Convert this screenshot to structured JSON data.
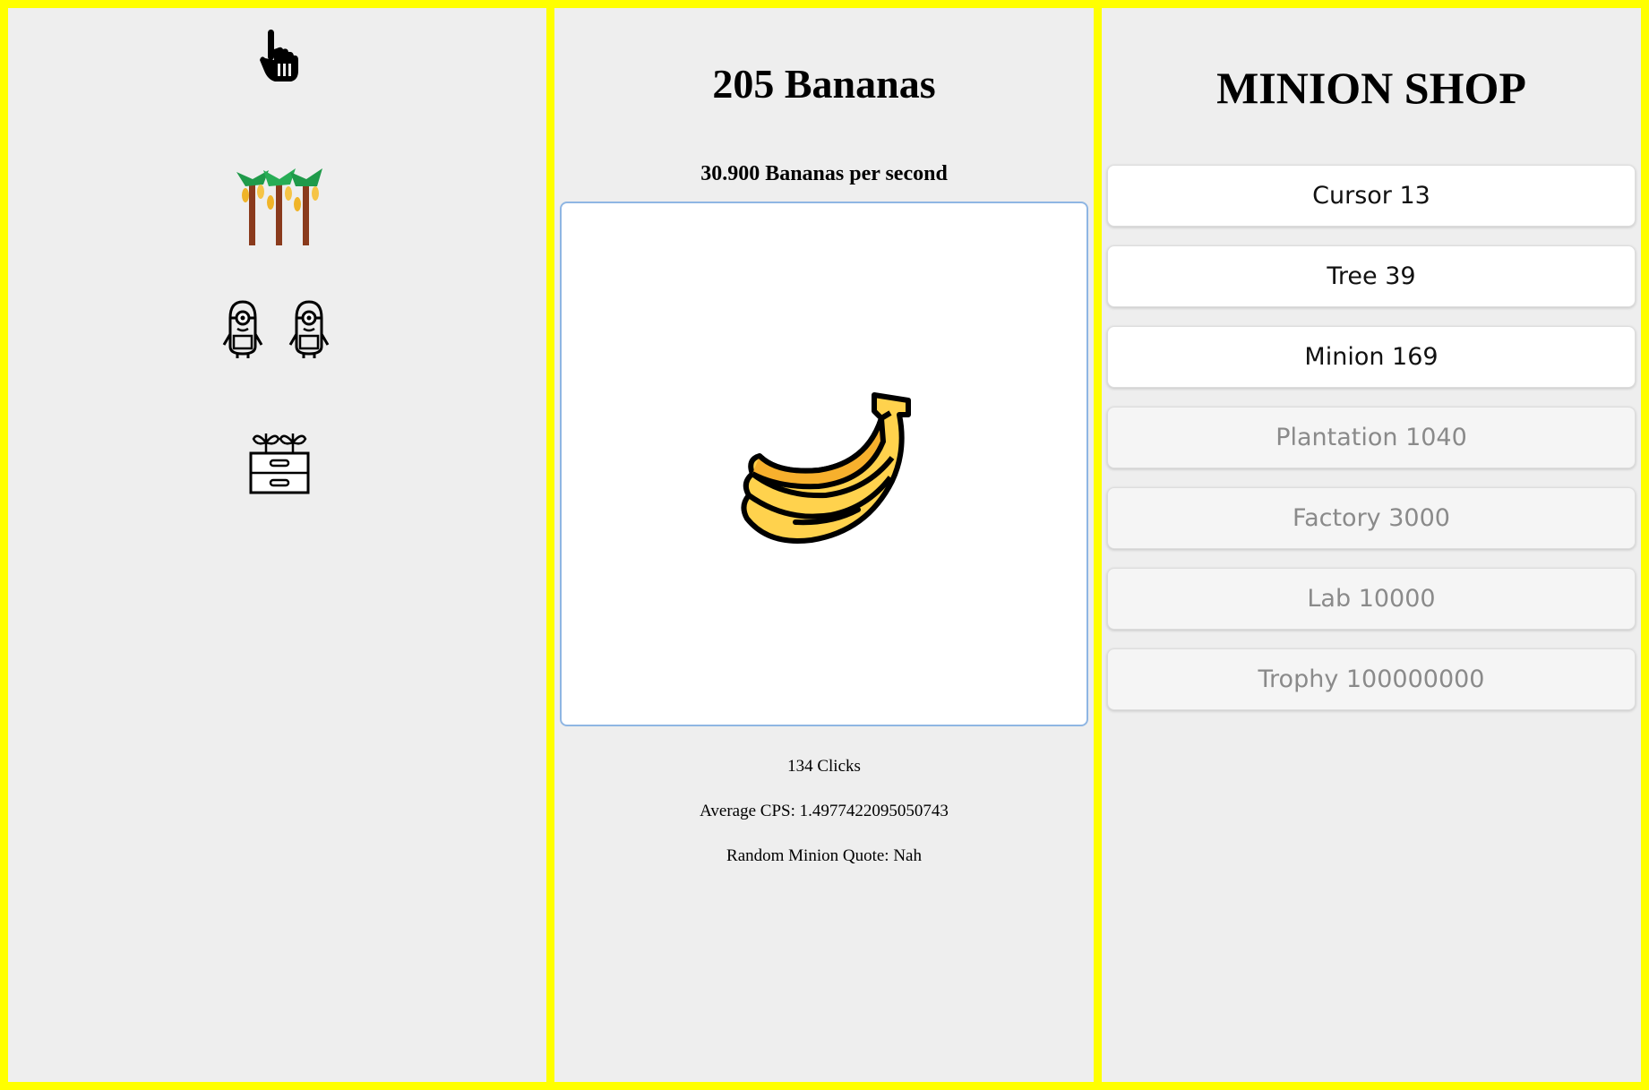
{
  "colors": {
    "frame": "#ffff00",
    "panel_bg": "#eeeeee",
    "button_border_accent": "#8fb6e3",
    "enabled_text": "#111111",
    "disabled_text": "#8a8a8a"
  },
  "owned": {
    "icons": [
      "cursor-icon",
      "banana-tree-icon",
      "minion-icon",
      "minion-icon",
      "plantation-icon"
    ]
  },
  "game": {
    "banana_count": "205 Bananas",
    "per_second": "30.900 Bananas per second",
    "banana_icon": "banana-icon",
    "clicks": "134 Clicks",
    "average_cps": "Average CPS: 1.4977422095050743",
    "quote": "Random Minion Quote:  Nah"
  },
  "shop": {
    "title": "MINION SHOP",
    "items": [
      {
        "label": "Cursor 13",
        "enabled": true
      },
      {
        "label": "Tree 39",
        "enabled": true
      },
      {
        "label": "Minion 169",
        "enabled": true
      },
      {
        "label": "Plantation 1040",
        "enabled": false
      },
      {
        "label": "Factory 3000",
        "enabled": false
      },
      {
        "label": "Lab 10000",
        "enabled": false
      },
      {
        "label": "Trophy 100000000",
        "enabled": false
      }
    ]
  }
}
